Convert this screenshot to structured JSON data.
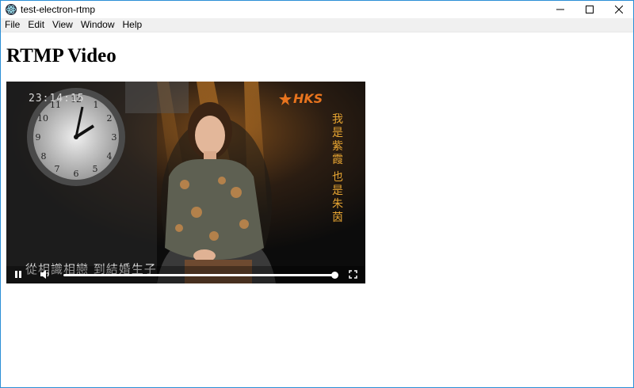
{
  "window": {
    "title": "test-electron-rtmp",
    "controls": [
      "minimize-icon",
      "maximize-icon",
      "close-icon"
    ]
  },
  "menubar": {
    "items": [
      {
        "label": "File"
      },
      {
        "label": "Edit"
      },
      {
        "label": "View"
      },
      {
        "label": "Window"
      },
      {
        "label": "Help"
      }
    ]
  },
  "page": {
    "heading": "RTMP Video"
  },
  "video": {
    "timestamp": "23:14:15",
    "logo_text": "HKS",
    "right_text_col1": "我是紫霞",
    "right_text_col2": "也是朱茵",
    "caption": "從相識相戀 到結婚生子",
    "progress": 1.0,
    "icons": [
      "pause-icon",
      "volume-icon",
      "fullscreen-icon"
    ]
  },
  "colors": {
    "window_border": "#2b8fd6",
    "menubar_bg": "#f0f0f0",
    "logo_orange": "#e8741e",
    "subtitle_gold": "#e7a532"
  }
}
